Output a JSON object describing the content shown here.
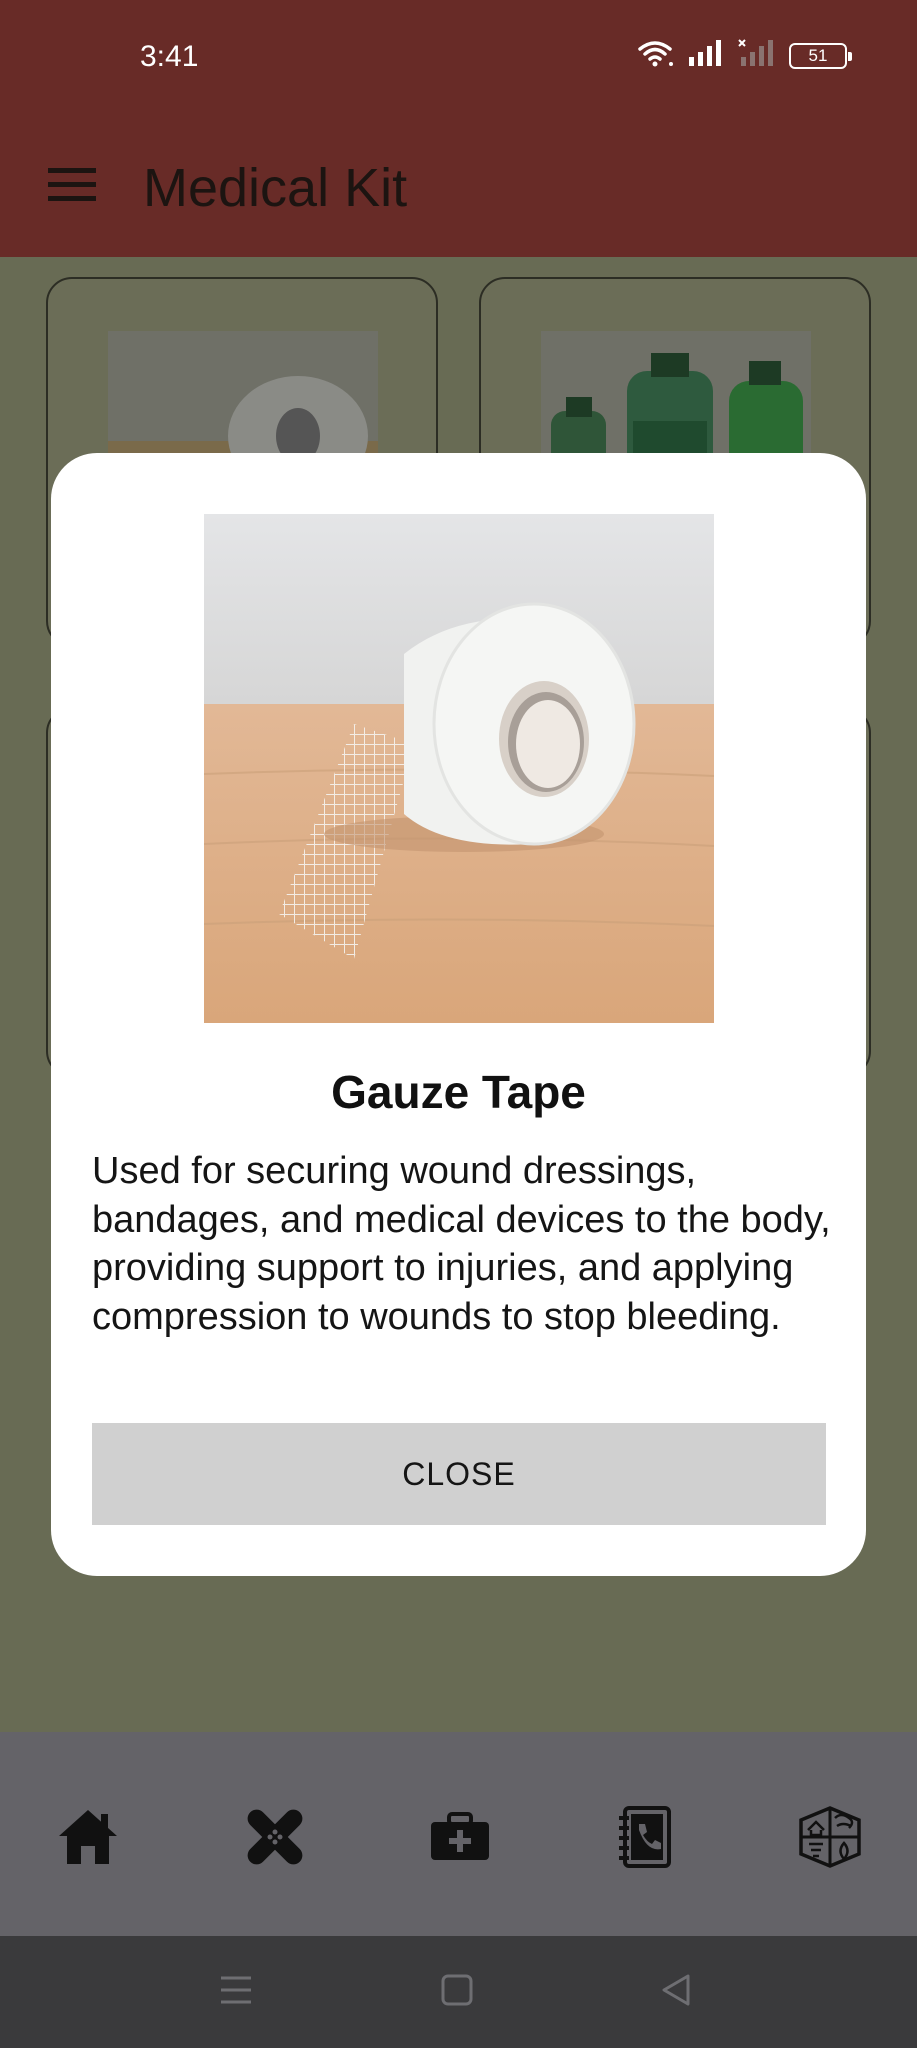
{
  "status_bar": {
    "time": "3:41",
    "battery": "51"
  },
  "app_bar": {
    "title": "Medical Kit"
  },
  "dialog": {
    "title": "Gauze Tape",
    "description": "Used for securing wound dressings, bandages, and medical devices to the body, providing support to injuries, and applying compression to wounds to stop bleeding.",
    "close_label": "CLOSE"
  },
  "bottom_nav": {
    "items": [
      {
        "icon": "home-icon"
      },
      {
        "icon": "bandage-icon"
      },
      {
        "icon": "medical-kit-icon"
      },
      {
        "icon": "contacts-book-icon"
      },
      {
        "icon": "disaster-guide-icon"
      }
    ]
  },
  "colors": {
    "app_bar": "#682b27",
    "overlay": "#686b54",
    "bottom_nav": "#646368",
    "system_nav": "#3a3a3c",
    "close_button": "#d0d0d0"
  }
}
